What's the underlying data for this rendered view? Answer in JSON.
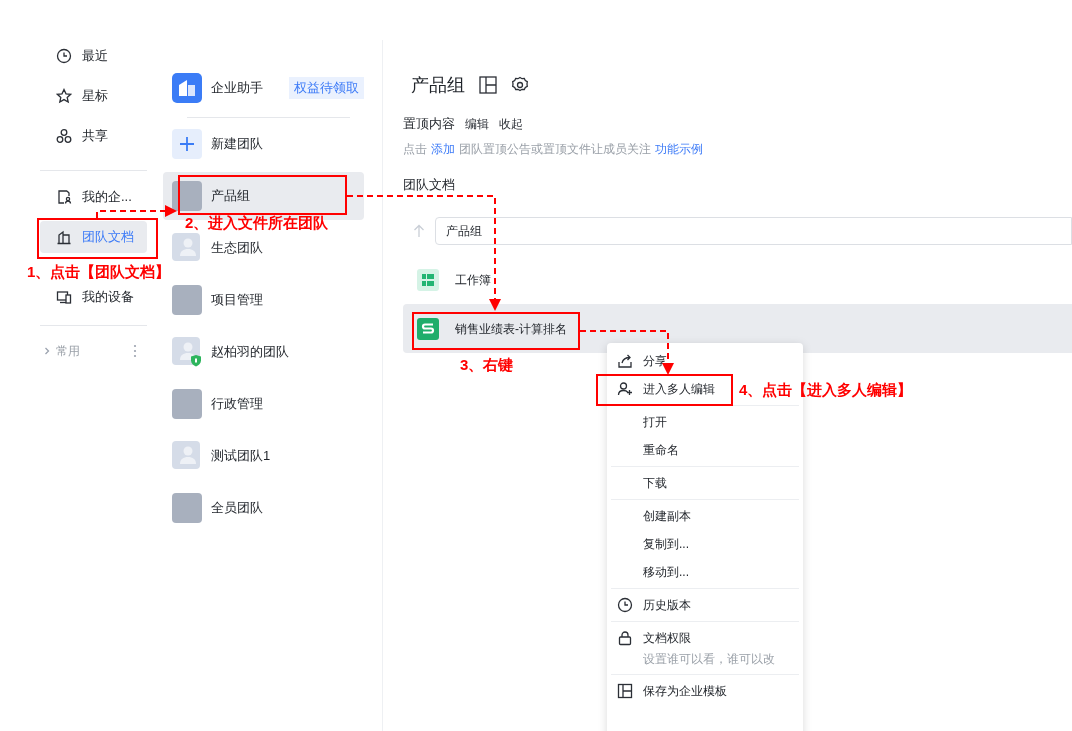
{
  "sidebar": {
    "groups": [
      [
        {
          "label": "最近",
          "kind": "clock",
          "selected": false
        },
        {
          "label": "星标",
          "kind": "star",
          "selected": false
        },
        {
          "label": "共享",
          "kind": "share",
          "selected": false
        }
      ],
      [
        {
          "label": "我的企...",
          "kind": "company",
          "selected": false
        },
        {
          "label": "团队文档",
          "kind": "team",
          "selected": true
        },
        {
          "label": "我的设备",
          "kind": "device",
          "selected": false
        }
      ]
    ],
    "section": {
      "label": "常用",
      "expanded": false
    }
  },
  "teams": {
    "items": [
      {
        "label": "企业助手",
        "kind": "assistant",
        "badge": "权益待领取",
        "selected": false
      },
      {
        "label": "新建团队",
        "kind": "create",
        "selected": false
      },
      {
        "label": "产品组",
        "kind": "photo",
        "selected": true
      },
      {
        "label": "生态团队",
        "kind": "generic",
        "selected": false
      },
      {
        "label": "项目管理",
        "kind": "photo",
        "selected": false
      },
      {
        "label": "赵柏羽的团队",
        "kind": "generic",
        "verified": true,
        "selected": false
      },
      {
        "label": "行政管理",
        "kind": "photo",
        "selected": false
      },
      {
        "label": "测试团队1",
        "kind": "generic",
        "selected": false
      },
      {
        "label": "全员团队",
        "kind": "photo",
        "selected": false
      }
    ]
  },
  "main": {
    "title": "产品组",
    "pinned": {
      "label": "置顶内容",
      "actions": [
        "编辑",
        "收起"
      ],
      "hint": [
        {
          "text": "点击",
          "link": false
        },
        {
          "text": "添加",
          "link": true
        },
        {
          "text": "团队置顶公告或置顶文件让成员关注",
          "link": false
        },
        {
          "text": "功能示例",
          "link": true
        }
      ]
    },
    "section_title": "团队文档",
    "breadcrumb": "产品组",
    "files": [
      {
        "name": "工作簿",
        "kind": "workbook",
        "selected": false
      },
      {
        "name": "销售业绩表-计算排名",
        "kind": "sheet",
        "selected": true
      }
    ]
  },
  "context_menu": {
    "groups": [
      [
        {
          "label": "分享",
          "kind": "share"
        },
        {
          "label": "进入多人编辑",
          "kind": "collab"
        }
      ],
      [
        {
          "label": "打开",
          "kind": "plain"
        },
        {
          "label": "重命名",
          "kind": "plain"
        }
      ],
      [
        {
          "label": "下载",
          "kind": "plain"
        }
      ],
      [
        {
          "label": "创建副本",
          "kind": "plain"
        },
        {
          "label": "复制到...",
          "kind": "plain"
        },
        {
          "label": "移动到...",
          "kind": "plain"
        }
      ],
      [
        {
          "label": "历史版本",
          "kind": "history"
        }
      ],
      [
        {
          "label": "文档权限",
          "kind": "lock",
          "description": "设置谁可以看，谁可以改"
        }
      ],
      [
        {
          "label": "保存为企业模板",
          "kind": "template"
        }
      ]
    ]
  },
  "annotations": [
    {
      "text": "1、点击【团队文档】"
    },
    {
      "text": "2、进入文件所在团队"
    },
    {
      "text": "3、右键"
    },
    {
      "text": "4、点击【进入多人编辑】"
    }
  ]
}
